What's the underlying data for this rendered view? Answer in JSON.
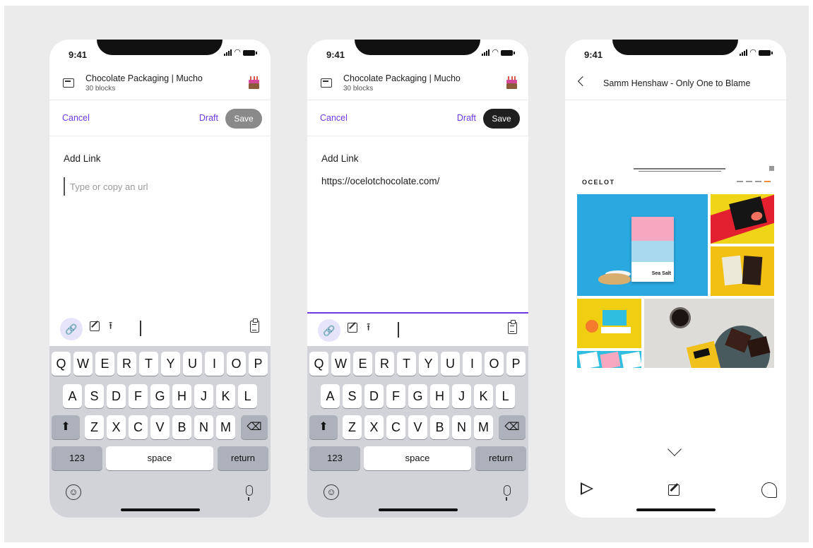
{
  "status": {
    "time": "9:41"
  },
  "channel": {
    "title": "Chocolate Packaging | Mucho",
    "subtitle": "30 blocks"
  },
  "actions": {
    "cancel": "Cancel",
    "draft": "Draft",
    "save": "Save"
  },
  "editor": {
    "add_link_label": "Add Link",
    "placeholder": "Type or copy an url",
    "url_value": "https://ocelotchocolate.com/"
  },
  "keyboard": {
    "row1": [
      "Q",
      "W",
      "E",
      "R",
      "T",
      "Y",
      "U",
      "I",
      "O",
      "P"
    ],
    "row2": [
      "A",
      "S",
      "D",
      "F",
      "G",
      "H",
      "J",
      "K",
      "L"
    ],
    "row3": [
      "Z",
      "X",
      "C",
      "V",
      "B",
      "N",
      "M"
    ],
    "numbers": "123",
    "space": "space",
    "return": "return"
  },
  "block": {
    "title": "Samm Henshaw - Only One to Blame",
    "preview": {
      "logo": "OCELOT",
      "product_label": "Sea Salt"
    }
  },
  "icons": {
    "toolbar": [
      "link-icon",
      "edit-icon",
      "upload-icon",
      "clipboard-icon"
    ],
    "footer": [
      "send-icon",
      "edit-icon",
      "comment-icon"
    ]
  },
  "colors": {
    "accent": "#6d3ae6",
    "save_disabled": "#8a8a8a",
    "save_active": "#1f1f1f",
    "keyboard_bg": "#d1d3d9"
  }
}
